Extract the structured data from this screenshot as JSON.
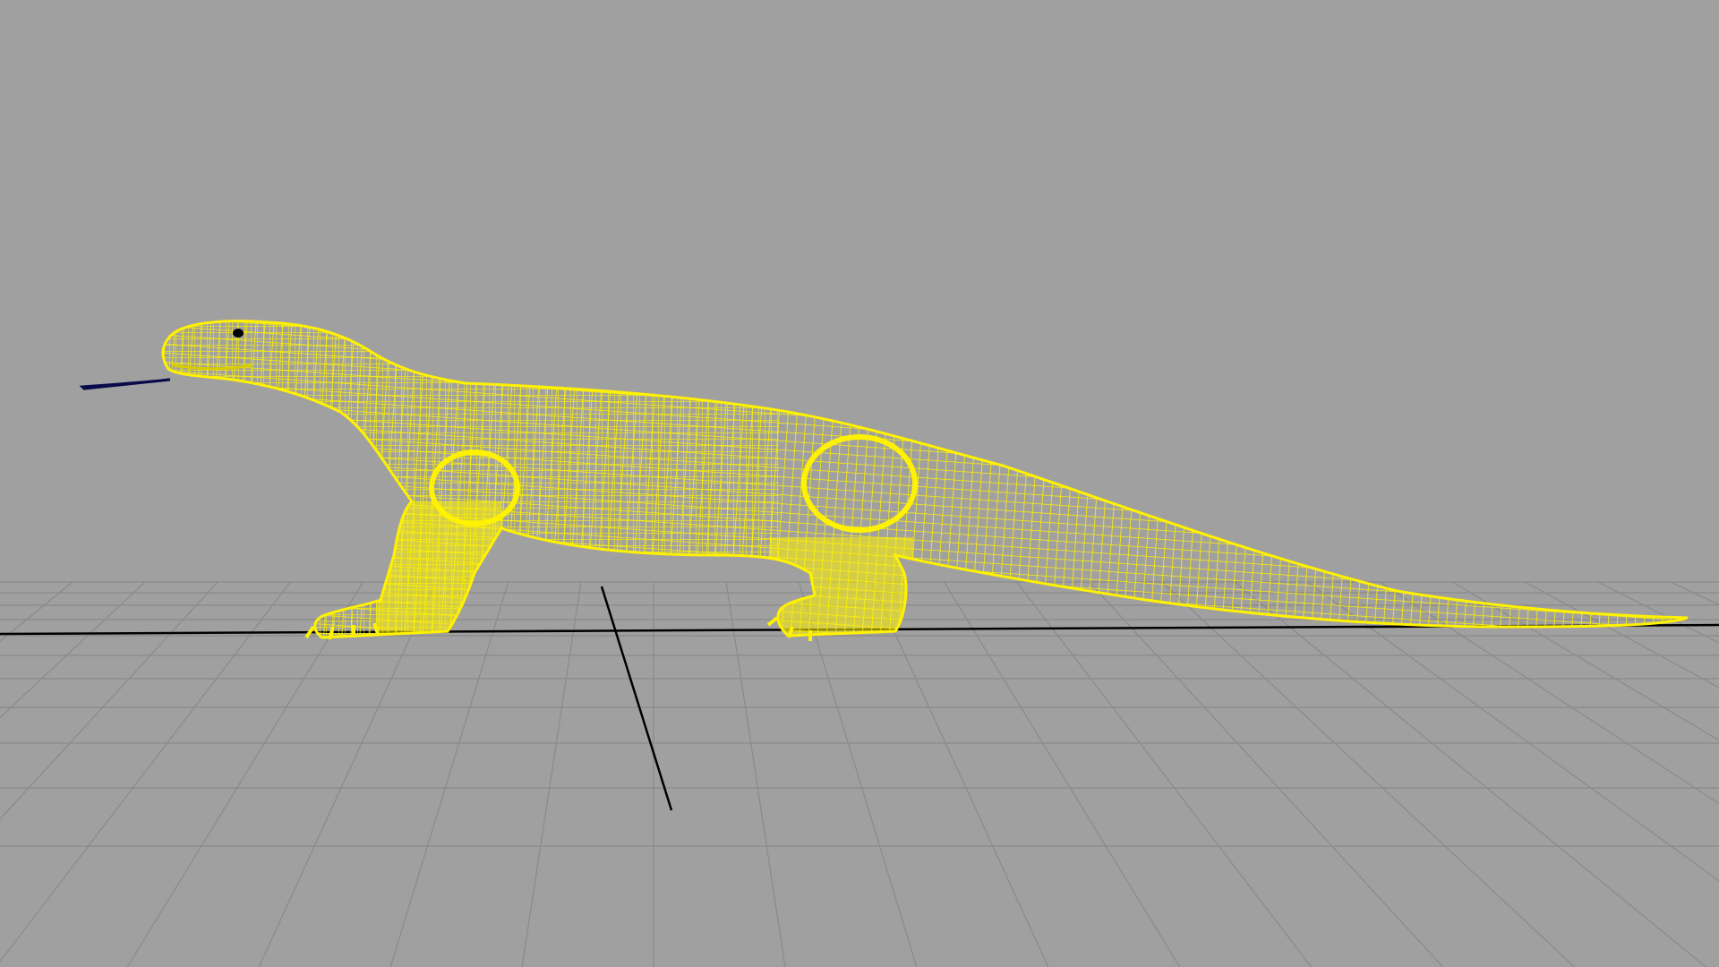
{
  "viewport": {
    "background": "#a0a0a0",
    "grid_color": "#8a8a8a",
    "axis_color": "#000000",
    "selection_color": "#ffff00",
    "tongue_color": "#0a0a4a",
    "eye_color": "#000000"
  },
  "scene": {
    "object": "lizard-wireframe-model",
    "shading": "wireframe",
    "selected": true
  }
}
